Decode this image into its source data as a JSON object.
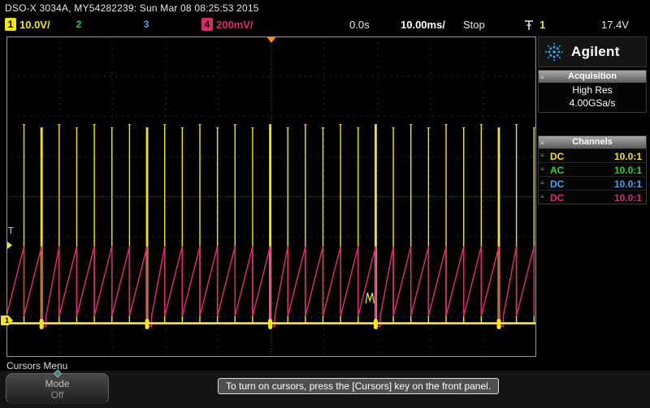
{
  "titlebar": {
    "text": "DSO-X 3034A, MY54282239: Sun Mar 08 08:25:53 2015"
  },
  "status_row": {
    "channels": [
      {
        "label": "1",
        "scale": "10.0V/",
        "color": "#f2e41c",
        "filled": true
      },
      {
        "label": "2",
        "scale": "",
        "color": "#33cc33",
        "filled": false
      },
      {
        "label": "3",
        "scale": "",
        "color": "#46a2ff",
        "filled": false
      },
      {
        "label": "4",
        "scale": "200mV/",
        "color": "#d92a6e",
        "filled": true
      }
    ],
    "delay": "0.0s",
    "timebase": "10.00ms/",
    "acq_state": "Stop",
    "trigger_source": "1",
    "trigger_level": "17.4V"
  },
  "sidebar": {
    "brand": "Agilent",
    "brand_icon": "agilent-spark-icon",
    "acquisition": {
      "title": "Acquisition",
      "mode": "High Res",
      "sample_rate": "4.00GSa/s"
    },
    "channels": {
      "title": "Channels",
      "rows": [
        {
          "coupling": "DC",
          "probe": "10.0:1",
          "color": "#f2e41c"
        },
        {
          "coupling": "AC",
          "probe": "10.0:1",
          "color": "#33cc33"
        },
        {
          "coupling": "DC",
          "probe": "10.0:1",
          "color": "#46a2ff"
        },
        {
          "coupling": "DC",
          "probe": "10.0:1",
          "color": "#d92a6e"
        }
      ]
    }
  },
  "bottom": {
    "menu_title": "Cursors Menu",
    "softkey": {
      "label": "Mode",
      "value": "Off"
    },
    "message": "To turn on cursors, press the [Cursors] key on the front panel."
  },
  "chart_data": {
    "type": "line",
    "title": "Oscilloscope waveform display",
    "x_axis": {
      "divisions": 10,
      "seconds_per_div": 0.01,
      "delay_s": 0.0
    },
    "y_axis": {
      "divisions": 8
    },
    "grid": true,
    "grid_color": "#4c4c34",
    "grid_center_color": "#6a6a4e",
    "border_color": "#999999",
    "series": [
      {
        "name": "channel-1",
        "color": "#f2e41c",
        "baseline_color": "#ffe92a",
        "volts_per_div": 10.0,
        "coupling": "DC",
        "shape": "pulse-train",
        "pulse_period_ms": 3.32,
        "first_pulse_ms": 3.3,
        "baseline_frac": 0.895,
        "pulse_top_frac": 0.275,
        "sync_times_ms": [
          6.4,
          28.0,
          49.6,
          71.2,
          92.8
        ]
      },
      {
        "name": "channel-4",
        "color": "#d92a6e",
        "volts_per_div": 0.2,
        "coupling": "DC",
        "shape": "sawtooth",
        "ramp_period_ms": 3.32,
        "ramp_bottom_frac": 0.873,
        "ramp_top_frac": 0.655,
        "sync_dip_frac": 0.905,
        "sync_dip_width_ms": 0.85
      }
    ],
    "artifact": {
      "time_ms": 68.6,
      "y_frac": 0.815
    },
    "trigger": {
      "source": 1,
      "level_v": 17.4,
      "time_marker_color": "#ff9015",
      "level_marker_frac": 0.615
    }
  }
}
